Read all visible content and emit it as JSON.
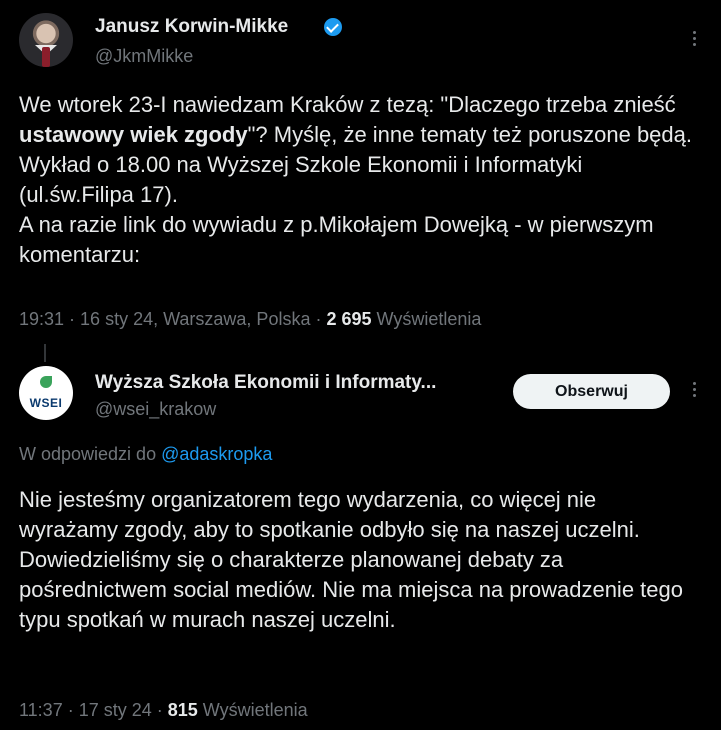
{
  "tweet1": {
    "author_name": "Janusz Korwin-Mikke",
    "author_handle": "@JkmMikke",
    "text_before_bold": "We wtorek 23-I nawiedzam Kraków z tezą: \"Dlaczego trzeba znieść ",
    "text_bold": "ustawowy wiek zgody",
    "text_after_bold": "\"? Myślę, że inne tematy też poruszone będą. Wykład o 18.00 na Wyższej Szkole Ekonomii i Informatyki (ul.św.Filipa 17).\nA na razie link do wywiadu z p.Mikołajem Dowejką - w pierwszym komentarzu:",
    "timestamp": "19:31 · 16 sty 24, Warszawa, Polska · ",
    "views_count": "2 695",
    "views_label": " Wyświetlenia"
  },
  "tweet2": {
    "author_name": "Wyższa Szkoła Ekonomii i Informaty...",
    "author_handle": "@wsei_krakow",
    "avatar_text": "WSEI",
    "follow_label": "Obserwuj",
    "reply_prefix": "W odpowiedzi do ",
    "reply_mention": "@adaskropka",
    "text": "Nie jesteśmy organizatorem tego wydarzenia, co więcej nie wyrażamy zgody, aby to spotkanie odbyło się na naszej uczelni. Dowiedzieliśmy się o charakterze planowanej debaty za pośrednictwem social mediów. Nie ma miejsca na prowadzenie tego typu spotkań w murach naszej uczelni.",
    "timestamp": "11:37 · 17 sty 24 · ",
    "views_count": "815",
    "views_label": " Wyświetlenia"
  },
  "icons": {
    "verified": "verified-badge-icon",
    "more": "more-options-icon"
  },
  "colors": {
    "background": "#000000",
    "text": "#e7e9ea",
    "muted": "#71767b",
    "accent": "#1d9bf0"
  }
}
